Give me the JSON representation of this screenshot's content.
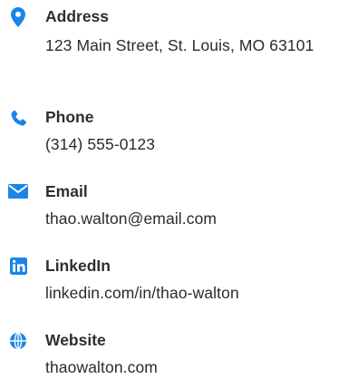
{
  "contact": {
    "accent_color": "#1a84e8",
    "items": [
      {
        "icon": "map-pin-icon",
        "label": "Address",
        "value": "123 Main Street, St. Louis, MO 63101"
      },
      {
        "icon": "phone-icon",
        "label": "Phone",
        "value": "(314) 555-0123"
      },
      {
        "icon": "envelope-icon",
        "label": "Email",
        "value": "thao.walton@email.com"
      },
      {
        "icon": "linkedin-icon",
        "label": "LinkedIn",
        "value": "linkedin.com/in/thao-walton"
      },
      {
        "icon": "globe-icon",
        "label": "Website",
        "value": "thaowalton.com"
      }
    ]
  }
}
